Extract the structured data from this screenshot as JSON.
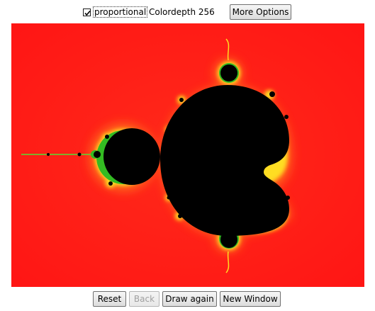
{
  "options": {
    "proportional_label": "proportional",
    "proportional_checked": true,
    "colordepth_label": "Colordepth 256",
    "more_options_label": "More Options"
  },
  "canvas": {
    "fractal": "mandelbrot-set",
    "colors": {
      "background": "#ff1a1a",
      "inner_glow": "#ffee33",
      "edge": "#33cc22",
      "set": "#000000"
    }
  },
  "buttons": {
    "reset_label": "Reset",
    "back_label": "Back",
    "back_enabled": false,
    "draw_again_label": "Draw again",
    "new_window_label": "New Window"
  }
}
